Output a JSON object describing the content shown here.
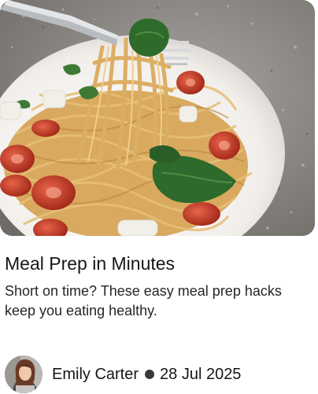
{
  "article": {
    "image": {
      "icon": "spaghetti-photo",
      "subject": "spaghetti with tomatoes and basil on a fork"
    },
    "title": "Meal Prep in Minutes",
    "description": "Short on time? These easy meal prep hacks keep you eating healthy.",
    "author": {
      "name": "Emily Carter",
      "avatar_icon": "avatar-photo"
    },
    "separator_icon": "dot-separator-icon",
    "date": "28 Jul 2025"
  },
  "colors": {
    "text": "#161616",
    "plate": "#f4f1ee",
    "pasta": "#d9a95c",
    "tomato": "#c8412b",
    "basil": "#2d6a2b",
    "countertop": "#8e8a86"
  }
}
